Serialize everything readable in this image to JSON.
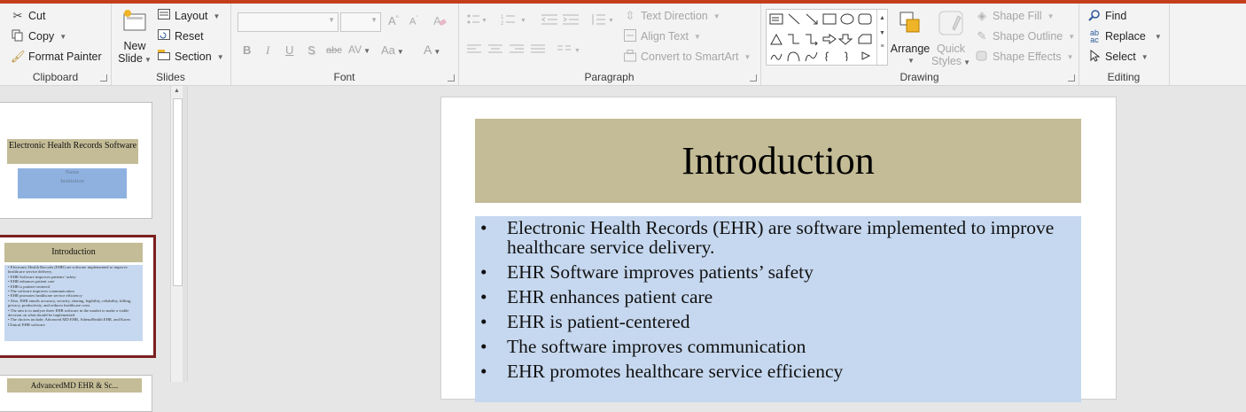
{
  "ribbon": {
    "clipboard": {
      "label": "Clipboard",
      "cut": "Cut",
      "copy": "Copy",
      "format_painter": "Format Painter"
    },
    "slides": {
      "label": "Slides",
      "new_slide_line1": "New",
      "new_slide_line2": "Slide",
      "layout": "Layout",
      "reset": "Reset",
      "section": "Section"
    },
    "font": {
      "label": "Font",
      "bold": "B",
      "italic": "I",
      "underline": "U",
      "shadow": "S",
      "strike": "abc",
      "spacing": "AV",
      "case": "Aa",
      "color": "A",
      "grow": "A",
      "shrink": "A"
    },
    "paragraph": {
      "label": "Paragraph",
      "text_direction": "Text Direction",
      "align_text": "Align Text",
      "convert_smartart": "Convert to SmartArt"
    },
    "drawing": {
      "label": "Drawing",
      "arrange": "Arrange",
      "quick_styles_line1": "Quick",
      "quick_styles_line2": "Styles",
      "shape_fill": "Shape Fill",
      "shape_outline": "Shape Outline",
      "shape_effects": "Shape Effects"
    },
    "editing": {
      "label": "Editing",
      "find": "Find",
      "replace": "Replace",
      "select": "Select"
    }
  },
  "thumbnails": [
    {
      "title": "Electronic Health Records Software",
      "subtitle_line1": "Name",
      "subtitle_line2": "Institution"
    },
    {
      "title": "Introduction",
      "bullets": [
        "Electronic Health Records (EHR) are software implemented to improve healthcare service delivery.",
        "EHR Software improves patients’ safety",
        "EHR enhances patient care",
        "EHR is patient-centered",
        "The software improves communication",
        "EHR promotes healthcare service efficiency",
        "Also, EHR entails accuracy, security, sharing, legibility, reliability, billing, privacy, productivity, and reduces healthcare costs",
        "The aim is to analyze three EHR software in the market to make a viable decision on what should be implemented",
        "The choices include; Advanced MD EHR, AthenaHealth EHR, and Kareo Clinical EHR software"
      ]
    },
    {
      "title": "AdvancedMD EHR & Sc..."
    }
  ],
  "slide": {
    "title": "Introduction",
    "bullets": [
      "Electronic Health Records (EHR) are software implemented to improve healthcare service delivery.",
      "EHR Software improves patients’ safety",
      "EHR enhances patient care",
      "EHR is patient-centered",
      "The software improves communication",
      "EHR promotes healthcare service efficiency"
    ]
  },
  "colors": {
    "title_fill": "#c4bc96",
    "body_fill": "#c6d8ef",
    "selected_border": "#7b1f1f",
    "accent": "#c43e1c"
  }
}
